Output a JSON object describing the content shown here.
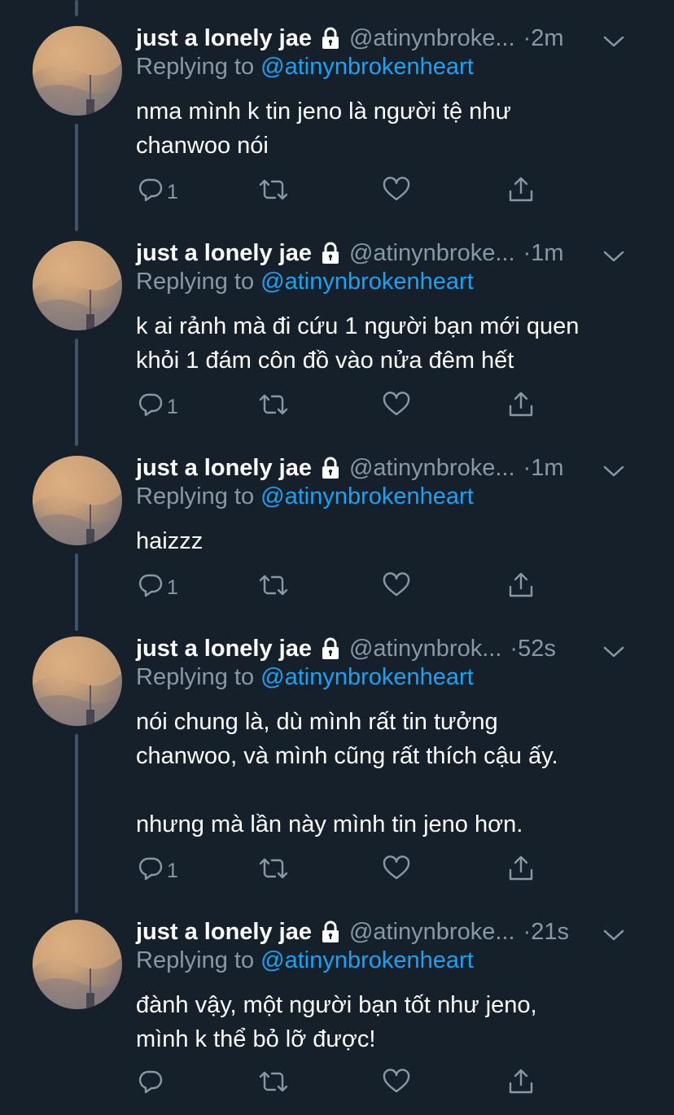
{
  "tweets": [
    {
      "name": "just a lonely jae",
      "handle": "@atinynbroke...",
      "time": "·2m",
      "replying_prefix": "Replying to ",
      "replying_to": "@atinynbrokenheart",
      "text": "nma mình k tin jeno là người tệ như\nchanwoo nói",
      "reply_count": "1"
    },
    {
      "name": "just a lonely jae",
      "handle": "@atinynbroke...",
      "time": "·1m",
      "replying_prefix": "Replying to ",
      "replying_to": "@atinynbrokenheart",
      "text": "k ai rảnh mà đi cứu 1 người bạn mới quen\nkhỏi 1 đám côn đồ vào nửa đêm hết",
      "reply_count": "1"
    },
    {
      "name": "just a lonely jae",
      "handle": "@atinynbroke...",
      "time": "·1m",
      "replying_prefix": "Replying to ",
      "replying_to": "@atinynbrokenheart",
      "text": "haizzz",
      "reply_count": "1"
    },
    {
      "name": "just a lonely jae",
      "handle": "@atinynbrok...",
      "time": "·52s",
      "replying_prefix": "Replying to ",
      "replying_to": "@atinynbrokenheart",
      "text": "nói chung là, dù mình rất tin tưởng\nchanwoo, và mình cũng rất thích cậu ấy.\n\nnhưng mà lần này mình tin jeno hơn.",
      "reply_count": "1"
    },
    {
      "name": "just a lonely jae",
      "handle": "@atinynbroke...",
      "time": "·21s",
      "replying_prefix": "Replying to ",
      "replying_to": "@atinynbrokenheart",
      "text": "đành vậy, một người bạn tốt như jeno,\nmình k thể bỏ lỡ được!",
      "reply_count": ""
    }
  ],
  "icons": {
    "reply": "reply-icon",
    "retweet": "retweet-icon",
    "like": "heart-icon",
    "share": "share-icon",
    "lock": "lock-icon",
    "caret": "chevron-down-icon"
  },
  "colors": {
    "background": "#15202b",
    "secondary_text": "#8899a6",
    "mention": "#1da1f2",
    "thread_line": "#3d5466"
  }
}
